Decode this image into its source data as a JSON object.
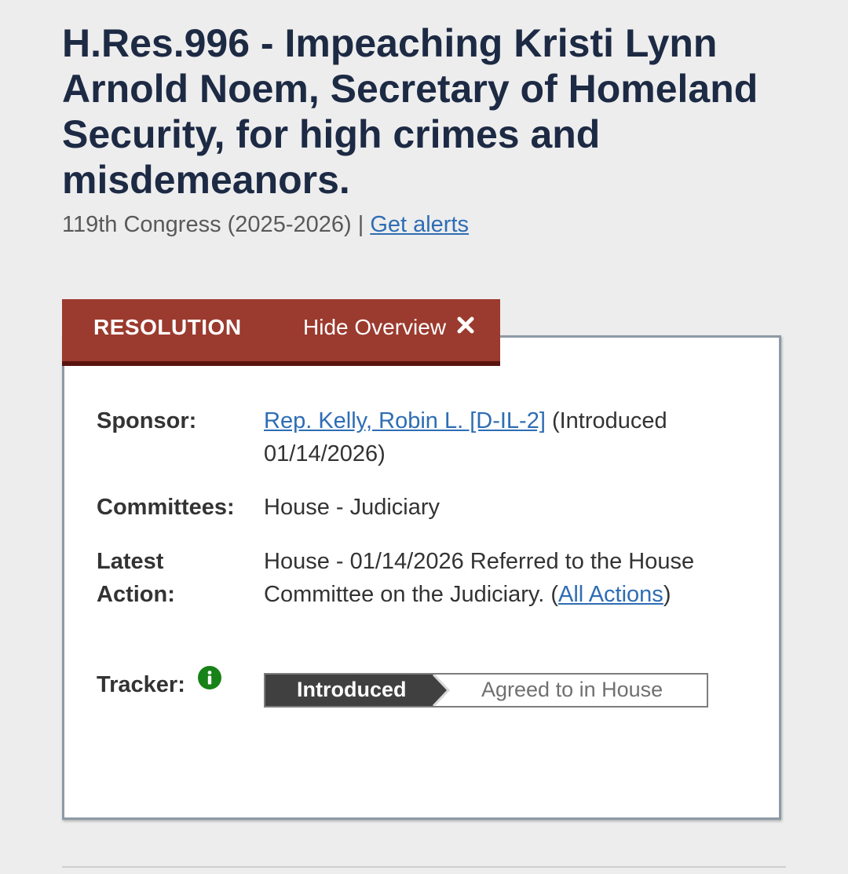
{
  "bill": {
    "title": "H.Res.996 - Impeaching Kristi Lynn Arnold Noem, Secretary of Homeland Security, for high crimes and misdemeanors.",
    "congress": "119th Congress (2025-2026) |",
    "alerts_link": "Get alerts"
  },
  "overview": {
    "type_label": "RESOLUTION",
    "hide_label": "Hide Overview",
    "colors": {
      "tab": "#9b3a2e",
      "tab_border": "#5a1410",
      "link": "#2e6db4",
      "tracker_current": "#404040",
      "info_icon": "#178217"
    },
    "sponsor": {
      "label": "Sponsor:",
      "name": "Rep. Kelly, Robin L. [D-IL-2]",
      "note": "(Introduced 01/14/2026)"
    },
    "committees": {
      "label": "Committees:",
      "value": "House - Judiciary"
    },
    "latest_action": {
      "label_line1": "Latest",
      "label_line2": "Action:",
      "text": "House - 01/14/2026 Referred to the House Committee on the Judiciary.",
      "open_paren": "(",
      "link": "All Actions",
      "close_paren": ")"
    },
    "tracker": {
      "label": "Tracker:",
      "info_icon": "info-icon",
      "current_stage": "Introduced",
      "next_stage": "Agreed to in House"
    }
  }
}
